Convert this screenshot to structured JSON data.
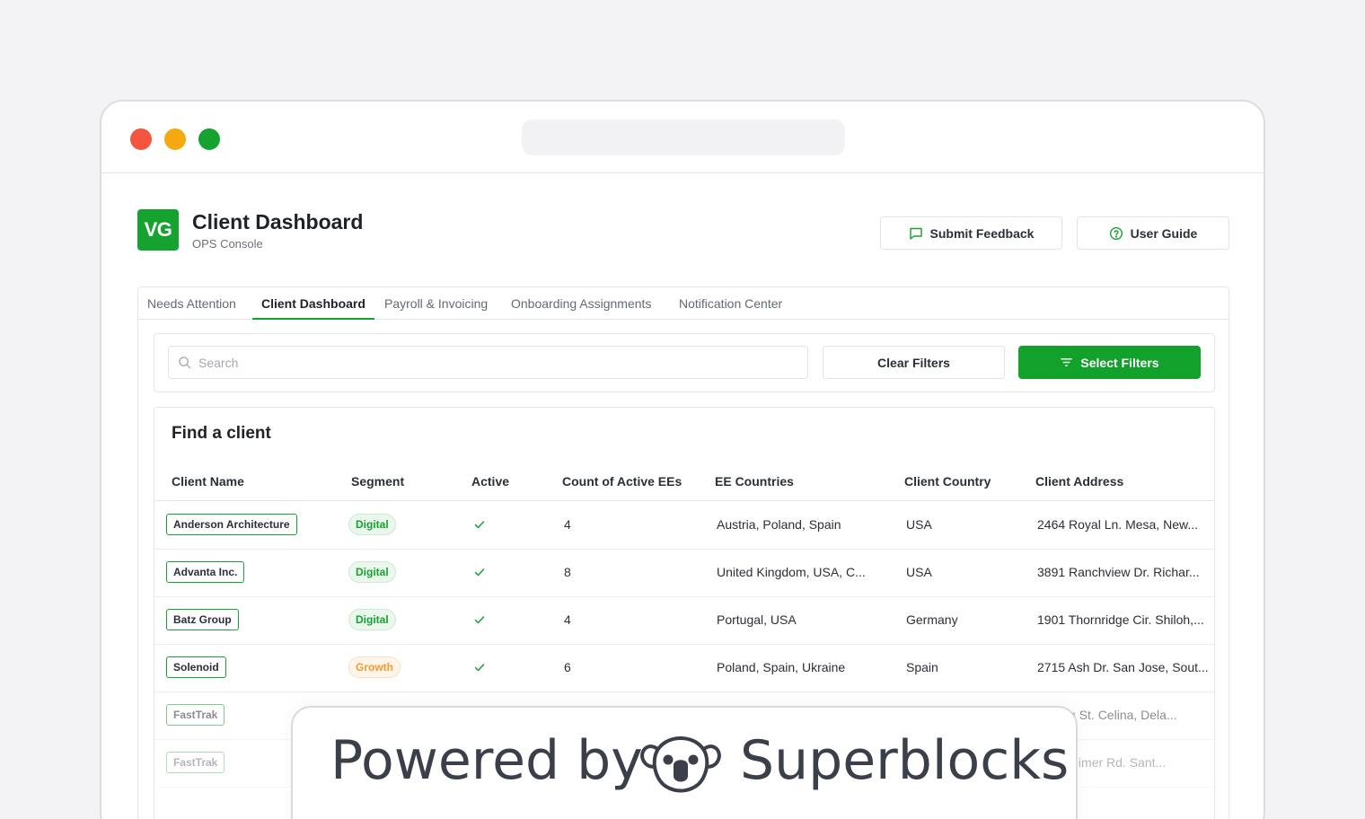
{
  "app": {
    "logo_text": "VG",
    "title": "Client Dashboard",
    "subtitle": "OPS Console",
    "accent_color": "#16a22f"
  },
  "header": {
    "feedback_label": "Submit Feedback",
    "feedback_icon": "message-square-icon",
    "guide_label": "User Guide",
    "guide_icon": "help-circle-icon"
  },
  "tabs": [
    {
      "label": "Needs Attention",
      "active": false
    },
    {
      "label": "Client Dashboard",
      "active": true
    },
    {
      "label": "Payroll & Invoicing",
      "active": false
    },
    {
      "label": "Onboarding Assignments",
      "active": false
    },
    {
      "label": "Notification Center",
      "active": false
    }
  ],
  "filters": {
    "search_placeholder": "Search",
    "clear_label": "Clear Filters",
    "select_label": "Select Filters"
  },
  "table": {
    "title": "Find a client",
    "columns": [
      "Client Name",
      "Segment",
      "Active",
      "Count of Active EEs",
      "EE Countries",
      "Client Country",
      "Client Address"
    ],
    "rows": [
      {
        "name": "Anderson Architecture",
        "segment": "Digital",
        "active": true,
        "count": "4",
        "countries": "Austria, Poland, Spain",
        "country": "USA",
        "address": "2464 Royal Ln. Mesa, New..."
      },
      {
        "name": "Advanta Inc.",
        "segment": "Digital",
        "active": true,
        "count": "8",
        "countries": "United Kingdom, USA, C...",
        "country": "USA",
        "address": "3891 Ranchview Dr. Richar..."
      },
      {
        "name": "Batz Group",
        "segment": "Digital",
        "active": true,
        "count": "4",
        "countries": "Portugal, USA",
        "country": "Germany",
        "address": "1901 Thornridge Cir. Shiloh,..."
      },
      {
        "name": "Solenoid",
        "segment": "Growth",
        "active": true,
        "count": "6",
        "countries": "Poland, Spain, Ukraine",
        "country": "Spain",
        "address": "2715 Ash Dr. San Jose, Sout..."
      },
      {
        "name": "FastTrak",
        "address": "...Elgin St. Celina, Dela..."
      },
      {
        "name": "FastTrak",
        "address": "...estheimer Rd. Sant..."
      }
    ]
  },
  "banner": {
    "text_left": "Powered by",
    "text_right": "Superblocks"
  }
}
